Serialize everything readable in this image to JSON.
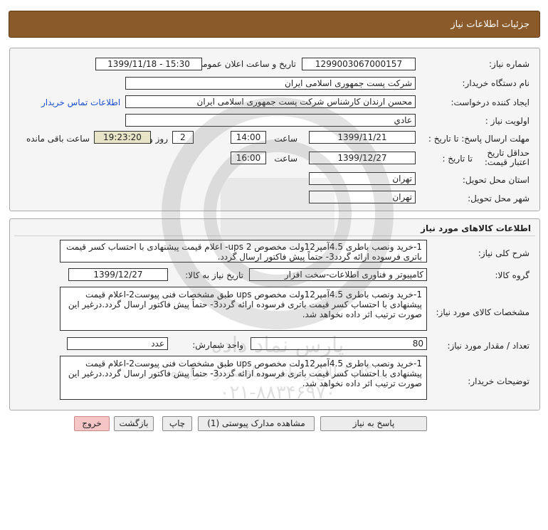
{
  "header": {
    "title": "جزئیات اطلاعات نیاز"
  },
  "details": {
    "need_number_label": "شماره نیاز:",
    "need_number": "1299003067000157",
    "announce_label": "تاریخ و ساعت اعلان عمومی:",
    "announce_value": "1399/11/18 - 15:30",
    "buyer_org_label": "نام دستگاه خریدار:",
    "buyer_org": "شرکت پست جمهوری اسلامی ایران",
    "creator_label": "ایجاد کننده درخواست:",
    "creator": "محسن ارندان کارشناس شرکت پست جمهوری اسلامی ایران",
    "contact_link": "اطلاعات تماس خریدار",
    "priority_label": "اولویت نیاز :",
    "priority": "عادي",
    "deadline_label": "مهلت ارسال پاسخ: تا تاریخ :",
    "deadline_date": "1399/11/21",
    "time_label": "ساعت",
    "deadline_time": "14:00",
    "days_value": "2",
    "days_label": "روز و",
    "remaining_time": "19:23:20",
    "remaining_label": "ساعت باقی مانده",
    "validity_label": "حداقل تاریخ اعتبار قیمت:",
    "validity_to_label": "تا تاریخ :",
    "validity_date": "1399/12/27",
    "validity_time_label": "ساعت",
    "validity_time": "16:00",
    "province_label": "استان محل تحویل:",
    "province": "تهران",
    "city_label": "شهر محل تحویل:",
    "city": "تهران"
  },
  "goods": {
    "title": "اطلاعات کالاهای مورد نیاز",
    "summary_label": "شرح کلی نیاز:",
    "summary": "1-خرید ونصب باطری 4.5آمپر12ولت مخصوص ups 2- اعلام قیمت پیشنهادی با احتساب کسر قیمت باتری فرسوده ارائه گردد3- حتماً پیش فاکتور ارسال گردد.",
    "group_label": "گروه کالا:",
    "group": "کامپیوتر و فناوری اطلاعات-سخت افزار",
    "need_date_label": "تاریخ نیاز به کالا:",
    "need_date": "1399/12/27",
    "specs_label": "مشخصات کالای مورد نیاز:",
    "specs": "1-خرید ونصب باطری 4.5آمپر12ولت مخصوص ups طبق مشخصات فنی پیوست2-اعلام قیمت پیشنهادی با احتساب کسر قیمت باتری فرسوده ارائه گردد3- حتماً پیش فاکتور ارسال گردد.درغیر این صورت ترتیب اثر داده نخواهد شد.",
    "qty_label": "تعداد / مقدار مورد نیاز:",
    "qty": "80",
    "unit_label": "واحد شمارش:",
    "unit": "عدد",
    "buyer_notes_label": "توضیحات خریدار:",
    "buyer_notes": "1-خرید ونصب باطری 4.5آمپر12ولت مخصوص ups طبق مشخصات فنی پیوست2-اعلام قیمت پیشنهادی با احتساب کسر قیمت باتری فرسوده ارائه گردد3- حتماً پیش فاکتور ارسال گردد.درغیر این صورت ترتیب اثر داده نخواهد شد."
  },
  "buttons": {
    "reply": "پاسخ به نیاز",
    "attachments": "مشاهده مدارک پیوستی (1)",
    "print": "چاپ",
    "back": "بازگشت",
    "exit": "خروج"
  },
  "watermark": {
    "name": "پارس نماد داده",
    "tagline": "پایگاه اطلاع رسانی مناقصه و مزایده",
    "phone": "۰۲۱-۸۸۳۴۶۹۷۰"
  },
  "colors": {
    "header_bg": "#8a5a2b",
    "link": "#1a4fd0",
    "exit_bg": "#f6c6c6"
  }
}
